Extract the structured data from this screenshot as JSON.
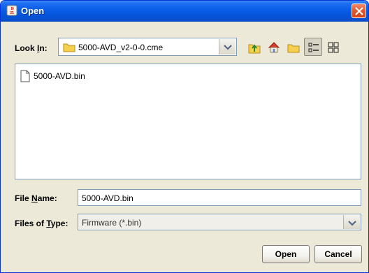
{
  "window": {
    "title": "Open"
  },
  "look_in": {
    "label_prefix": "Look ",
    "label_mnemonic": "I",
    "label_suffix": "n:",
    "value": "5000-AVD_v2-0-0.cme"
  },
  "toolbar": {
    "icons": [
      "up-folder-icon",
      "home-icon",
      "new-folder-icon",
      "list-view-icon",
      "details-view-icon"
    ]
  },
  "files": [
    {
      "name": "5000-AVD.bin",
      "icon": "file-icon"
    }
  ],
  "file_name": {
    "label_prefix": "File ",
    "label_mnemonic": "N",
    "label_suffix": "ame:",
    "value": "5000-AVD.bin"
  },
  "file_type": {
    "label_prefix": "Files of ",
    "label_mnemonic": "T",
    "label_suffix": "ype:",
    "value": "Firmware (*.bin)"
  },
  "buttons": {
    "open": "Open",
    "cancel": "Cancel"
  }
}
